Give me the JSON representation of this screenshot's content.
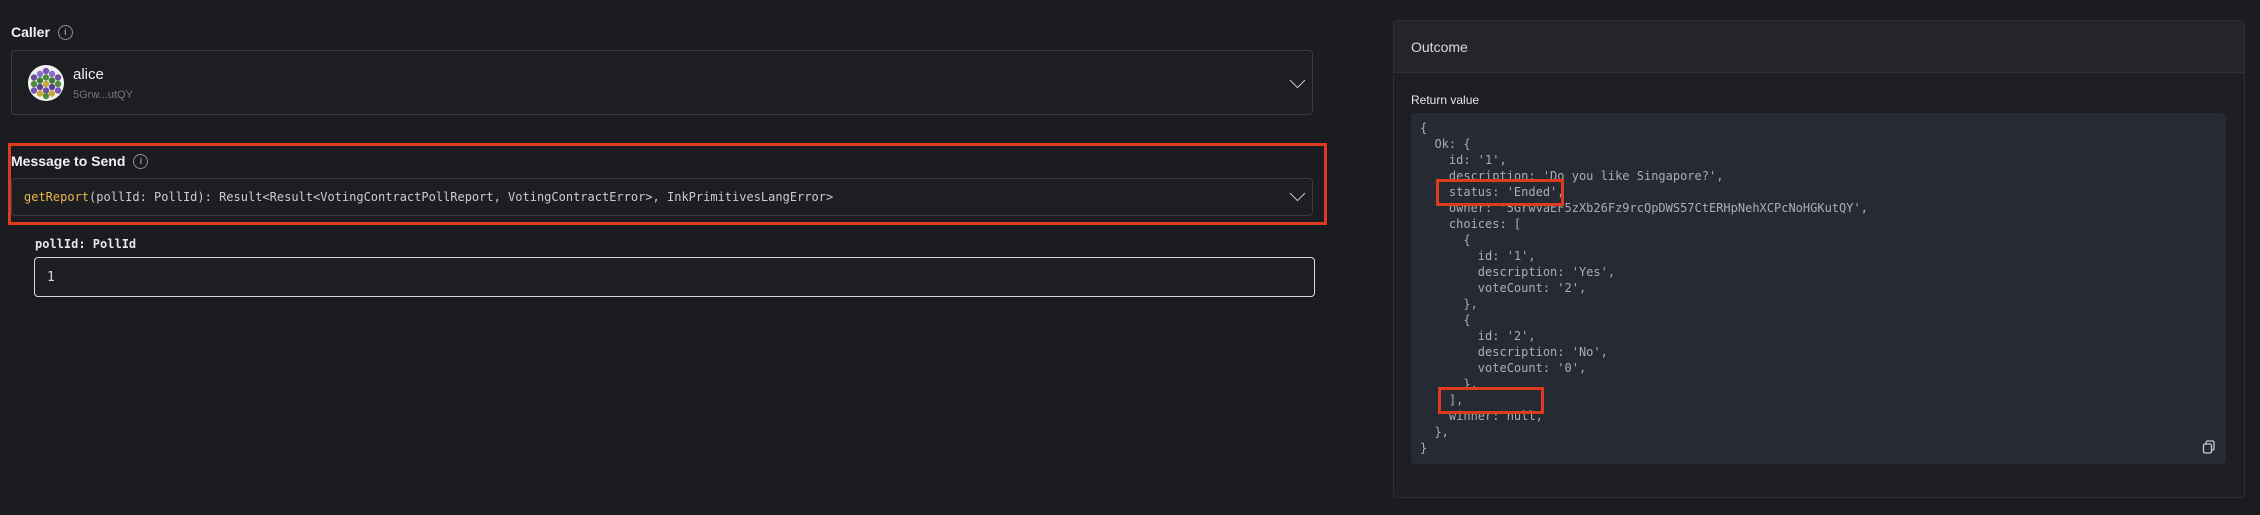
{
  "caller": {
    "label": "Caller",
    "name": "alice",
    "address": "5Grw...utQY"
  },
  "message": {
    "label": "Message to Send",
    "fn_name": "getReport",
    "signature": "(pollId: PollId): Result<Result<VotingContractPollReport, VotingContractError>, InkPrimitivesLangError>"
  },
  "param": {
    "label": "pollId: PollId",
    "value": "1"
  },
  "outcome": {
    "title": "Outcome",
    "return_label": "Return value",
    "lines": [
      "{",
      "  Ok: {",
      "    id: '1',",
      "    description: 'Do you like Singapore?',",
      "    status: 'Ended',",
      "    owner: '5GrwvaEF5zXb26Fz9rcQpDWS57CtERHpNehXCPcNoHGKutQY',",
      "    choices: [",
      "      {",
      "        id: '1',",
      "        description: 'Yes',",
      "        voteCount: '2',",
      "      },",
      "      {",
      "        id: '2',",
      "        description: 'No',",
      "        voteCount: '0',",
      "      },",
      "    ],",
      "    winner: null,",
      "  },",
      "}"
    ]
  },
  "colors": {
    "highlight": "#dd3a1f",
    "fn_name": "#e9b94a",
    "background": "#1b1c1f"
  },
  "icons": [
    "info-icon",
    "chevron-down-icon",
    "avatar-identicon",
    "copy-icon"
  ]
}
